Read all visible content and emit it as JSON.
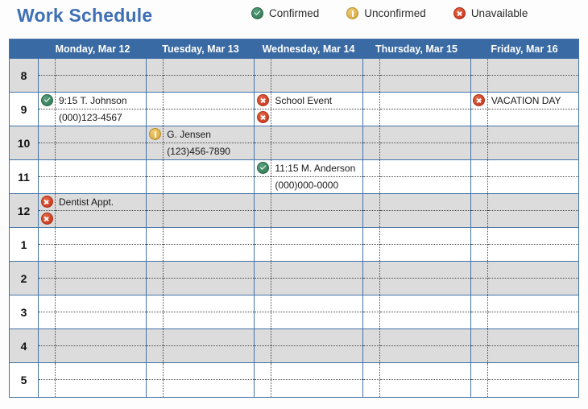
{
  "header": {
    "title": "Work Schedule"
  },
  "legend": {
    "items": [
      {
        "icon": "check-circle-icon",
        "status": "confirmed",
        "label": "Confirmed"
      },
      {
        "icon": "exclamation-circle-icon",
        "status": "unconfirmed",
        "label": "Unconfirmed"
      },
      {
        "icon": "x-circle-icon",
        "status": "unavailable",
        "label": "Unavailable"
      }
    ]
  },
  "calendar": {
    "day_columns": [
      "Monday, Mar 12",
      "Tuesday, Mar 13",
      "Wednesday, Mar 14",
      "Thursday, Mar 15",
      "Friday, Mar 16"
    ],
    "hours": [
      "8",
      "9",
      "10",
      "11",
      "12",
      "1",
      "2",
      "3",
      "4",
      "5"
    ],
    "rows": [
      {
        "hour": "8",
        "shaded": true,
        "days": [
          {
            "top": {
              "icon": "",
              "text": ""
            },
            "bottom": {
              "icon": "",
              "text": ""
            }
          },
          {
            "top": {
              "icon": "",
              "text": ""
            },
            "bottom": {
              "icon": "",
              "text": ""
            }
          },
          {
            "top": {
              "icon": "",
              "text": ""
            },
            "bottom": {
              "icon": "",
              "text": ""
            }
          },
          {
            "top": {
              "icon": "",
              "text": ""
            },
            "bottom": {
              "icon": "",
              "text": ""
            }
          },
          {
            "top": {
              "icon": "",
              "text": ""
            },
            "bottom": {
              "icon": "",
              "text": ""
            }
          }
        ]
      },
      {
        "hour": "9",
        "shaded": false,
        "days": [
          {
            "top": {
              "icon": "confirmed",
              "text": "9:15 T. Johnson"
            },
            "bottom": {
              "icon": "",
              "text": "(000)123-4567"
            }
          },
          {
            "top": {
              "icon": "",
              "text": ""
            },
            "bottom": {
              "icon": "",
              "text": ""
            }
          },
          {
            "top": {
              "icon": "unavailable",
              "text": "School Event"
            },
            "bottom": {
              "icon": "unavailable",
              "text": ""
            }
          },
          {
            "top": {
              "icon": "",
              "text": ""
            },
            "bottom": {
              "icon": "",
              "text": ""
            }
          },
          {
            "top": {
              "icon": "unavailable",
              "text": "VACATION DAY"
            },
            "bottom": {
              "icon": "",
              "text": ""
            }
          }
        ]
      },
      {
        "hour": "10",
        "shaded": true,
        "days": [
          {
            "top": {
              "icon": "",
              "text": ""
            },
            "bottom": {
              "icon": "",
              "text": ""
            }
          },
          {
            "top": {
              "icon": "unconfirmed",
              "text": "G. Jensen"
            },
            "bottom": {
              "icon": "",
              "text": "(123)456-7890"
            }
          },
          {
            "top": {
              "icon": "",
              "text": ""
            },
            "bottom": {
              "icon": "",
              "text": ""
            }
          },
          {
            "top": {
              "icon": "",
              "text": ""
            },
            "bottom": {
              "icon": "",
              "text": ""
            }
          },
          {
            "top": {
              "icon": "",
              "text": ""
            },
            "bottom": {
              "icon": "",
              "text": ""
            }
          }
        ]
      },
      {
        "hour": "11",
        "shaded": false,
        "days": [
          {
            "top": {
              "icon": "",
              "text": ""
            },
            "bottom": {
              "icon": "",
              "text": ""
            }
          },
          {
            "top": {
              "icon": "",
              "text": ""
            },
            "bottom": {
              "icon": "",
              "text": ""
            }
          },
          {
            "top": {
              "icon": "confirmed",
              "text": "11:15 M. Anderson"
            },
            "bottom": {
              "icon": "",
              "text": "(000)000-0000"
            }
          },
          {
            "top": {
              "icon": "",
              "text": ""
            },
            "bottom": {
              "icon": "",
              "text": ""
            }
          },
          {
            "top": {
              "icon": "",
              "text": ""
            },
            "bottom": {
              "icon": "",
              "text": ""
            }
          }
        ]
      },
      {
        "hour": "12",
        "shaded": true,
        "days": [
          {
            "top": {
              "icon": "unavailable",
              "text": "Dentist Appt."
            },
            "bottom": {
              "icon": "unavailable",
              "text": ""
            }
          },
          {
            "top": {
              "icon": "",
              "text": ""
            },
            "bottom": {
              "icon": "",
              "text": ""
            }
          },
          {
            "top": {
              "icon": "",
              "text": ""
            },
            "bottom": {
              "icon": "",
              "text": ""
            }
          },
          {
            "top": {
              "icon": "",
              "text": ""
            },
            "bottom": {
              "icon": "",
              "text": ""
            }
          },
          {
            "top": {
              "icon": "",
              "text": ""
            },
            "bottom": {
              "icon": "",
              "text": ""
            }
          }
        ]
      },
      {
        "hour": "1",
        "shaded": false,
        "days": [
          {
            "top": {
              "icon": "",
              "text": ""
            },
            "bottom": {
              "icon": "",
              "text": ""
            }
          },
          {
            "top": {
              "icon": "",
              "text": ""
            },
            "bottom": {
              "icon": "",
              "text": ""
            }
          },
          {
            "top": {
              "icon": "",
              "text": ""
            },
            "bottom": {
              "icon": "",
              "text": ""
            }
          },
          {
            "top": {
              "icon": "",
              "text": ""
            },
            "bottom": {
              "icon": "",
              "text": ""
            }
          },
          {
            "top": {
              "icon": "",
              "text": ""
            },
            "bottom": {
              "icon": "",
              "text": ""
            }
          }
        ]
      },
      {
        "hour": "2",
        "shaded": true,
        "days": [
          {
            "top": {
              "icon": "",
              "text": ""
            },
            "bottom": {
              "icon": "",
              "text": ""
            }
          },
          {
            "top": {
              "icon": "",
              "text": ""
            },
            "bottom": {
              "icon": "",
              "text": ""
            }
          },
          {
            "top": {
              "icon": "",
              "text": ""
            },
            "bottom": {
              "icon": "",
              "text": ""
            }
          },
          {
            "top": {
              "icon": "",
              "text": ""
            },
            "bottom": {
              "icon": "",
              "text": ""
            }
          },
          {
            "top": {
              "icon": "",
              "text": ""
            },
            "bottom": {
              "icon": "",
              "text": ""
            }
          }
        ]
      },
      {
        "hour": "3",
        "shaded": false,
        "days": [
          {
            "top": {
              "icon": "",
              "text": ""
            },
            "bottom": {
              "icon": "",
              "text": ""
            }
          },
          {
            "top": {
              "icon": "",
              "text": ""
            },
            "bottom": {
              "icon": "",
              "text": ""
            }
          },
          {
            "top": {
              "icon": "",
              "text": ""
            },
            "bottom": {
              "icon": "",
              "text": ""
            }
          },
          {
            "top": {
              "icon": "",
              "text": ""
            },
            "bottom": {
              "icon": "",
              "text": ""
            }
          },
          {
            "top": {
              "icon": "",
              "text": ""
            },
            "bottom": {
              "icon": "",
              "text": ""
            }
          }
        ]
      },
      {
        "hour": "4",
        "shaded": true,
        "days": [
          {
            "top": {
              "icon": "",
              "text": ""
            },
            "bottom": {
              "icon": "",
              "text": ""
            }
          },
          {
            "top": {
              "icon": "",
              "text": ""
            },
            "bottom": {
              "icon": "",
              "text": ""
            }
          },
          {
            "top": {
              "icon": "",
              "text": ""
            },
            "bottom": {
              "icon": "",
              "text": ""
            }
          },
          {
            "top": {
              "icon": "",
              "text": ""
            },
            "bottom": {
              "icon": "",
              "text": ""
            }
          },
          {
            "top": {
              "icon": "",
              "text": ""
            },
            "bottom": {
              "icon": "",
              "text": ""
            }
          }
        ]
      },
      {
        "hour": "5",
        "shaded": false,
        "days": [
          {
            "top": {
              "icon": "",
              "text": ""
            },
            "bottom": {
              "icon": "",
              "text": ""
            }
          },
          {
            "top": {
              "icon": "",
              "text": ""
            },
            "bottom": {
              "icon": "",
              "text": ""
            }
          },
          {
            "top": {
              "icon": "",
              "text": ""
            },
            "bottom": {
              "icon": "",
              "text": ""
            }
          },
          {
            "top": {
              "icon": "",
              "text": ""
            },
            "bottom": {
              "icon": "",
              "text": ""
            }
          },
          {
            "top": {
              "icon": "",
              "text": ""
            },
            "bottom": {
              "icon": "",
              "text": ""
            }
          }
        ]
      }
    ]
  },
  "colors": {
    "title": "#3f6fb5",
    "header_blue": "#3a6aa3",
    "grid_line": "#4473a8",
    "row_shade": "#dcdcdc",
    "confirmed": "#3d8761",
    "unconfirmed": "#e0b44e",
    "unavailable": "#d4442a"
  }
}
